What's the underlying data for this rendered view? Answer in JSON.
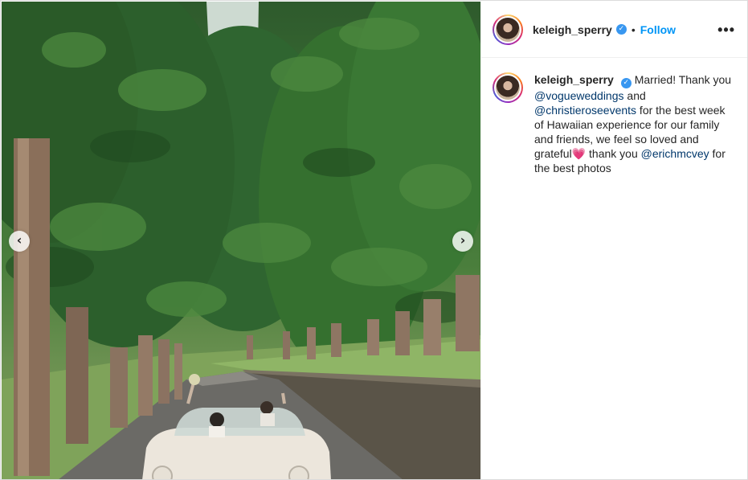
{
  "post": {
    "username": "keleigh_sperry",
    "verified_mark": "✓",
    "separator": "•",
    "follow_label": "Follow",
    "more_label": "•••",
    "caption": {
      "username": "keleigh_sperry",
      "text_1": "Married! Thank you ",
      "mention_1": "@vogueweddings",
      "text_2": " and ",
      "mention_2": "@christieroseevents",
      "text_3": " for the best week of Hawaiian experience for our family and friends, we feel so loved and grateful",
      "emoji": "💗",
      "text_4": " thank you ",
      "mention_3": "@erichmcvey",
      "text_5": " for the best photos"
    }
  },
  "carousel": {
    "prev_glyph": "‹",
    "next_glyph": "›"
  },
  "icons": {
    "prev": "chevron-left-icon",
    "next": "chevron-right-icon",
    "verified": "verified-badge-icon",
    "more": "more-options-icon"
  },
  "colors": {
    "follow": "#0095f6",
    "mention": "#00376b",
    "verified": "#3897f0"
  }
}
